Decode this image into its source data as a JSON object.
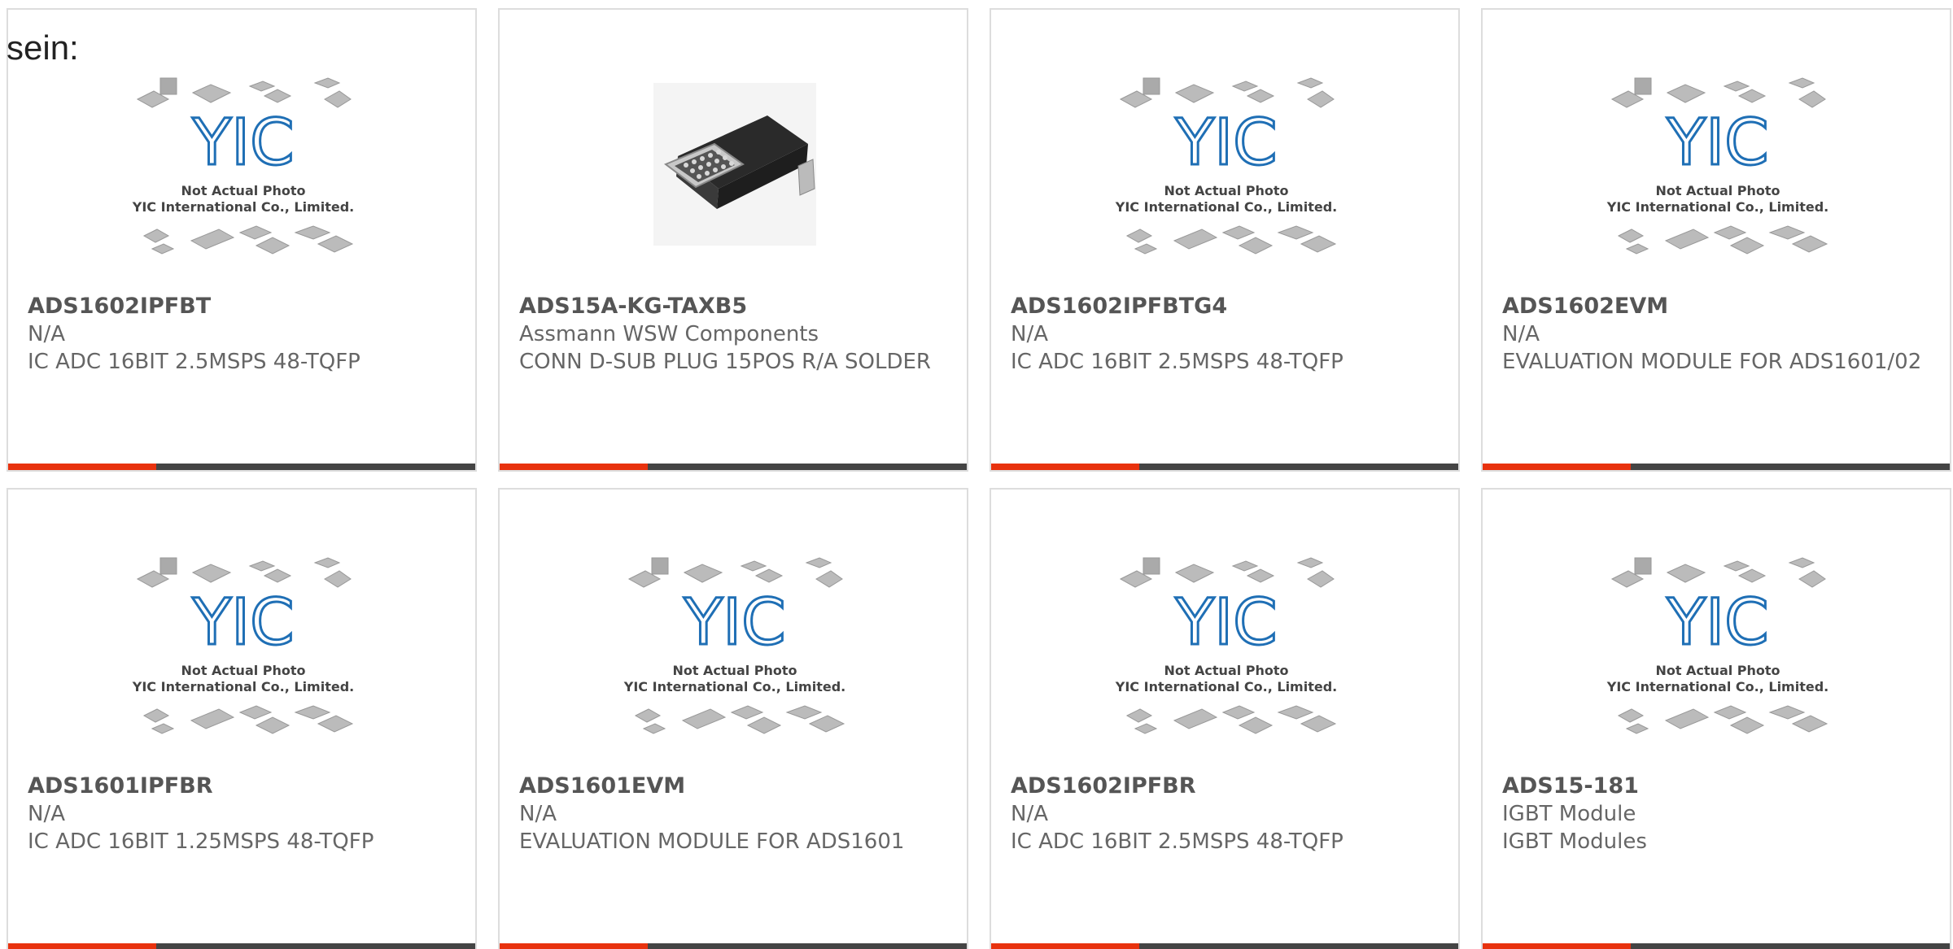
{
  "intro": {
    "text": "sein:"
  },
  "placeholder": {
    "logo_text": "YIC",
    "line1": "Not Actual Photo",
    "line2": "YIC International Co., Limited."
  },
  "colors": {
    "accent": "#e8320e",
    "bar": "#444444",
    "logo_blue": "#1f6fb5",
    "text": "#666666"
  },
  "products": [
    {
      "part_no": "ADS1602IPFBT",
      "manufacturer": "N/A",
      "description": "IC ADC 16BIT 2.5MSPS 48-TQFP",
      "image": "placeholder"
    },
    {
      "part_no": "ADS15A-KG-TAXB5",
      "manufacturer": "Assmann WSW Components",
      "description": "CONN D-SUB PLUG 15POS R/A SOLDER",
      "image": "dsub-connector"
    },
    {
      "part_no": "ADS1602IPFBTG4",
      "manufacturer": "N/A",
      "description": "IC ADC 16BIT 2.5MSPS 48-TQFP",
      "image": "placeholder"
    },
    {
      "part_no": "ADS1602EVM",
      "manufacturer": "N/A",
      "description": "EVALUATION MODULE FOR ADS1601/02",
      "image": "placeholder"
    },
    {
      "part_no": "ADS1601IPFBR",
      "manufacturer": "N/A",
      "description": "IC ADC 16BIT 1.25MSPS 48-TQFP",
      "image": "placeholder"
    },
    {
      "part_no": "ADS1601EVM",
      "manufacturer": "N/A",
      "description": "EVALUATION MODULE FOR ADS1601",
      "image": "placeholder"
    },
    {
      "part_no": "ADS1602IPFBR",
      "manufacturer": "N/A",
      "description": "IC ADC 16BIT 2.5MSPS 48-TQFP",
      "image": "placeholder"
    },
    {
      "part_no": "ADS15-181",
      "manufacturer": "IGBT Module",
      "description": "IGBT Modules",
      "image": "placeholder"
    }
  ]
}
